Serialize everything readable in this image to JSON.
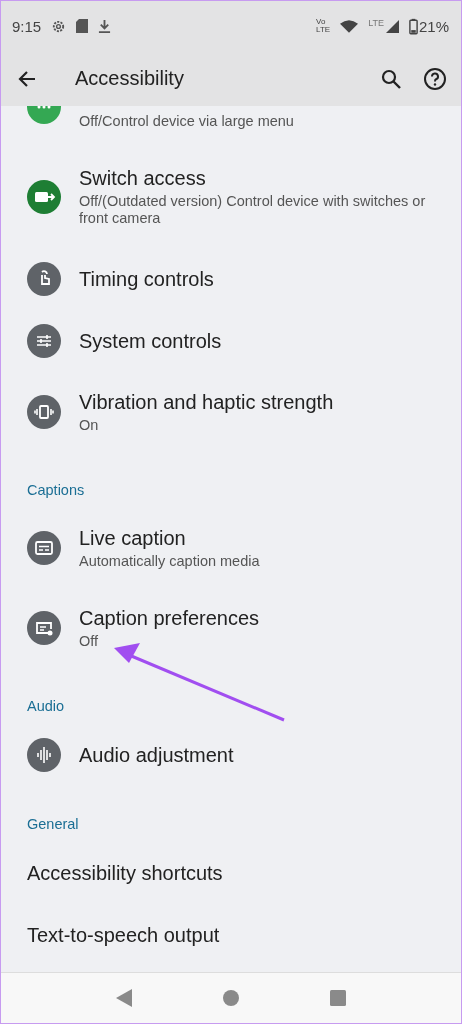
{
  "status_bar": {
    "time": "9:15",
    "volte": [
      "Vo",
      "LTE"
    ],
    "network": "LTE",
    "battery": "21%"
  },
  "app_bar": {
    "title": "Accessibility"
  },
  "sections": [
    {
      "items": [
        {
          "kind": "menu",
          "color": "#34a853",
          "subtitle": "Off/Control device via large menu",
          "partial": true
        }
      ]
    },
    {
      "items": [
        {
          "kind": "switch",
          "color": "#1e7e34",
          "title": "Switch access",
          "subtitle": "Off/(Outdated version) Control device with switches or front camera"
        },
        {
          "kind": "timing",
          "color": "#5f6368",
          "title": "Timing controls"
        },
        {
          "kind": "system",
          "color": "#5f6368",
          "title": "System controls"
        },
        {
          "kind": "vibration",
          "color": "#5f6368",
          "title": "Vibration and haptic strength",
          "subtitle": "On"
        }
      ]
    },
    {
      "header": "Captions",
      "items": [
        {
          "kind": "caption",
          "color": "#5f6368",
          "title": "Live caption",
          "subtitle": "Automatically caption media"
        },
        {
          "kind": "captionsettings",
          "color": "#5f6368",
          "title": "Caption preferences",
          "subtitle": "Off"
        }
      ]
    },
    {
      "header": "Audio",
      "items": [
        {
          "kind": "audio",
          "color": "#5f6368",
          "title": "Audio adjustment"
        }
      ]
    },
    {
      "header": "General",
      "items": [
        {
          "kind": "plain",
          "title": "Accessibility shortcuts"
        },
        {
          "kind": "plain",
          "title": "Text-to-speech output"
        }
      ]
    }
  ]
}
